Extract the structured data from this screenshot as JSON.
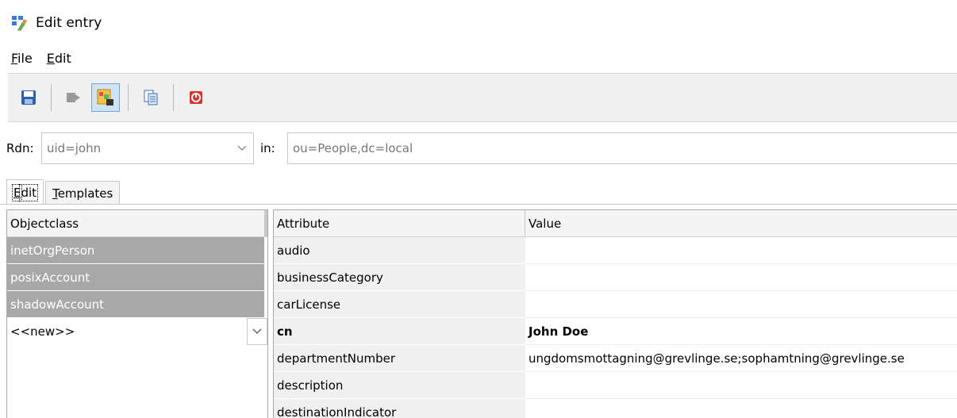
{
  "window": {
    "title": "Edit entry"
  },
  "menu": [
    {
      "key": "F",
      "rest": "ile"
    },
    {
      "key": "E",
      "rest": "dit"
    }
  ],
  "toolbar": {
    "buttons": [
      {
        "icon": "save-icon"
      },
      {
        "icon": "forward-icon"
      },
      {
        "icon": "template-edit-icon",
        "active": true
      },
      {
        "icon": "copy-icon"
      },
      {
        "icon": "close-icon"
      }
    ]
  },
  "rdn": {
    "label": "Rdn:",
    "value": "uid=john",
    "in_label": "in:",
    "in_value": "ou=People,dc=local"
  },
  "tabs": [
    {
      "key": "E",
      "rest": "dit",
      "active": true
    },
    {
      "key": "T",
      "rest": "emplates",
      "active": false
    }
  ],
  "objectclass": {
    "header": "Objectclass",
    "items": [
      "inetOrgPerson",
      "posixAccount",
      "shadowAccount"
    ],
    "new_label": "<<new>>"
  },
  "attributes": {
    "header_attr": "Attribute",
    "header_value": "Value",
    "rows": [
      {
        "name": "audio",
        "value": "",
        "bold": false
      },
      {
        "name": "businessCategory",
        "value": "",
        "bold": false
      },
      {
        "name": "carLicense",
        "value": "",
        "bold": false
      },
      {
        "name": "cn",
        "value": "John Doe",
        "bold": true
      },
      {
        "name": "departmentNumber",
        "value": "ungdomsmottagning@grevlinge.se;sophamtning@grevlinge.se",
        "bold": false
      },
      {
        "name": "description",
        "value": "",
        "bold": false
      },
      {
        "name": "destinationIndicator",
        "value": "",
        "bold": false
      }
    ]
  }
}
